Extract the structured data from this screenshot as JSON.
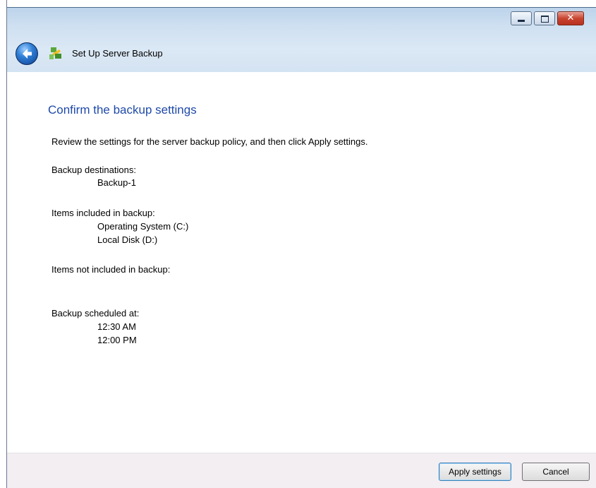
{
  "window": {
    "title": "Set Up Server Backup",
    "caption_buttons": [
      "minimize-icon",
      "maximize-icon",
      "close-icon"
    ],
    "close_glyph": "✕"
  },
  "page": {
    "heading": "Confirm the backup settings",
    "intro": "Review the settings for the server backup policy, and then click Apply settings."
  },
  "sections": {
    "destinations": {
      "label": "Backup destinations:",
      "items": [
        "Backup-1"
      ]
    },
    "included": {
      "label": "Items included in backup:",
      "items": [
        "Operating System (C:)",
        "Local Disk (D:)"
      ]
    },
    "not_included": {
      "label": "Items not included in backup:",
      "items": []
    },
    "schedule": {
      "label": "Backup scheduled at:",
      "items": [
        "12:30 AM",
        "12:00 PM"
      ]
    }
  },
  "footer": {
    "apply_label": "Apply settings",
    "cancel_label": "Cancel"
  },
  "colors": {
    "heading": "#1f4aa8",
    "titlebar": "#cfe0f1",
    "footer": "#f2eef2"
  }
}
